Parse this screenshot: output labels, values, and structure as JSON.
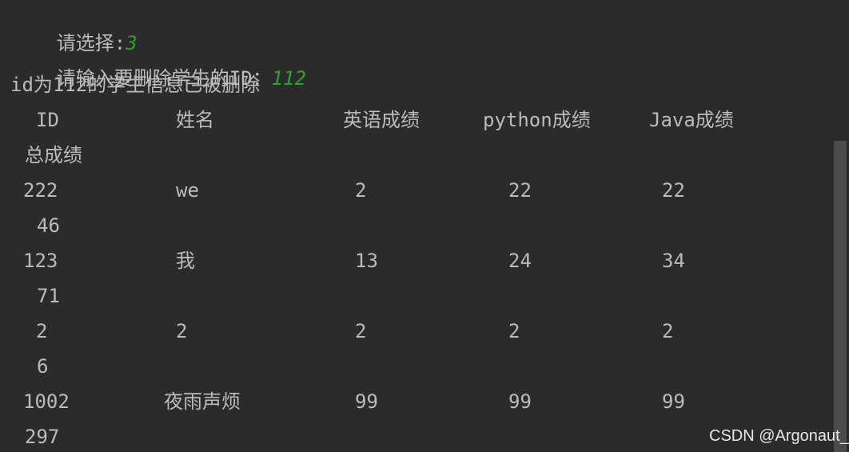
{
  "console": {
    "prompt_choose": "请选择:",
    "choice_value": "3",
    "prompt_delete": "请输入要删除学生的ID：",
    "delete_value": "112",
    "result_message": "id为112的学生信息已被删除"
  },
  "table": {
    "headers": {
      "id": "ID",
      "name": "姓名",
      "english": "英语成绩",
      "python": "python成绩",
      "java": "Java成绩",
      "total": "总成绩"
    },
    "rows": [
      {
        "id": "222",
        "name": "we",
        "english": "2",
        "python": "22",
        "java": "22",
        "total": "46"
      },
      {
        "id": "123",
        "name": "我",
        "english": "13",
        "python": "24",
        "java": "34",
        "total": "71"
      },
      {
        "id": "2",
        "name": "2",
        "english": "2",
        "python": "2",
        "java": "2",
        "total": "6"
      },
      {
        "id": "1002",
        "name": "夜雨声烦",
        "english": "99",
        "python": "99",
        "java": "99",
        "total": "297"
      }
    ]
  },
  "watermark": "CSDN @Argonaut_"
}
